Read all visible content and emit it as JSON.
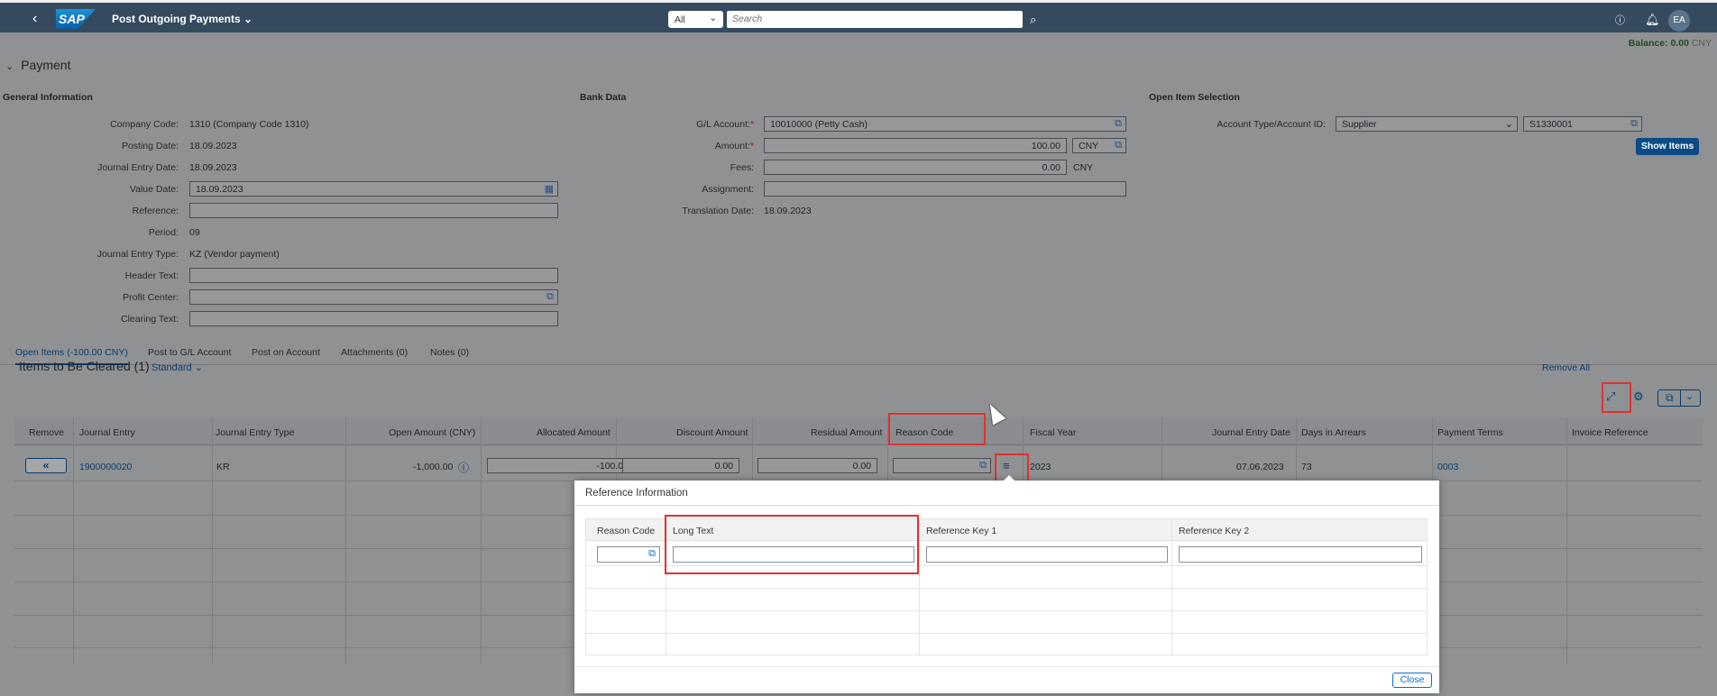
{
  "shell": {
    "title": "Post Outgoing Payments",
    "logo_text": "SAP",
    "scope": "All",
    "search_placeholder": "Search",
    "avatar": "EA"
  },
  "balance": {
    "label": "Balance: 0.00",
    "unit": "CNY"
  },
  "section_title": "Payment",
  "general": {
    "title": "General Information",
    "fields": [
      {
        "label": "Company Code:",
        "value": "1310 (Company Code 1310)"
      },
      {
        "label": "Posting Date:",
        "value": "18.09.2023"
      },
      {
        "label": "Journal Entry Date:",
        "value": "18.09.2023"
      },
      {
        "label": "Value Date:",
        "value": "18.09.2023"
      },
      {
        "label": "Reference:",
        "value": ""
      },
      {
        "label": "Period:",
        "value": "09"
      },
      {
        "label": "Journal Entry Type:",
        "value": "KZ (Vendor payment)"
      },
      {
        "label": "Header Text:",
        "value": ""
      },
      {
        "label": "Profit Center:",
        "value": ""
      },
      {
        "label": "Clearing Text:",
        "value": ""
      }
    ]
  },
  "bank": {
    "title": "Bank Data",
    "gl_label": "G/L Account:",
    "gl_value": "10010000 (Petty Cash)",
    "amount_label": "Amount:",
    "amount_value": "100.00",
    "amount_currency": "CNY",
    "fees_label": "Fees:",
    "fees_value": "0.00",
    "fees_currency": "CNY",
    "assignment_label": "Assignment:",
    "translation_label": "Translation Date:",
    "translation_value": "18.09.2023"
  },
  "open_item": {
    "title": "Open Item Selection",
    "acct_label": "Account Type/Account ID:",
    "acct_type": "Supplier",
    "acct_id": "S1330001",
    "show_items": "Show Items"
  },
  "tabs": [
    "Open Items (-100.00 CNY)",
    "Post to G/L Account",
    "Post on Account",
    "Attachments (0)",
    "Notes (0)"
  ],
  "items": {
    "title": "Items to Be Cleared (1)",
    "variant": "Standard",
    "remove_all": "Remove All",
    "columns": [
      "Remove",
      "Journal Entry",
      "Journal Entry Type",
      "Open Amount (CNY)",
      "Allocated Amount",
      "Discount Amount",
      "Residual Amount",
      "Reason Code",
      "Fiscal Year",
      "Journal Entry Date",
      "Days in Arrears",
      "Payment Terms",
      "Invoice Reference"
    ],
    "row": {
      "journal_entry": "1900000020",
      "type": "KR",
      "open_amount": "-1,000.00",
      "allocated": "-100.00",
      "discount": "0.00",
      "residual": "0.00",
      "fiscal_year": "2023",
      "entry_date": "07.06.2023",
      "days_arrears": "73",
      "payment_terms": "0003"
    }
  },
  "dialog": {
    "title": "Reference Information",
    "columns": [
      "Reason Code",
      "Long Text",
      "Reference Key 1",
      "Reference Key 2"
    ],
    "close": "Close"
  }
}
